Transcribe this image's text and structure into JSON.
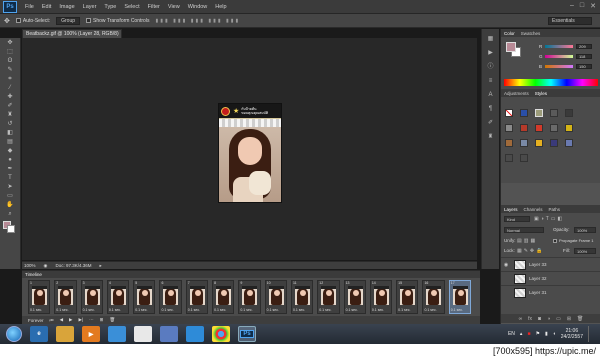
{
  "app": {
    "logo": "Ps",
    "window_controls": [
      "–",
      "□",
      "✕"
    ]
  },
  "menu": [
    "File",
    "Edit",
    "Image",
    "Layer",
    "Type",
    "Select",
    "Filter",
    "View",
    "Window",
    "Help"
  ],
  "options": {
    "auto_select_label": "Auto-Select:",
    "auto_select_value": "Group",
    "transform_label": "Show Transform Controls",
    "workspace": "Essentials"
  },
  "document": {
    "tab_label": "Beatbackz.gif @ 100% (Layer 28, RGB/8) *",
    "banner_text_line1": "กับป้ายต้น",
    "banner_text_line2": "ขอบคุณคุณสมบัติ",
    "zoom": "100%",
    "doc_info": "Doc: 97.3K/4.36M"
  },
  "color_panel": {
    "tabs": [
      "Color",
      "Swatches"
    ],
    "channels": [
      {
        "label": "R",
        "value": "209"
      },
      {
        "label": "G",
        "value": "118"
      },
      {
        "label": "B",
        "value": "150"
      }
    ],
    "fg_color": "#b88a96"
  },
  "styles_panel": {
    "tabs": [
      "Adjustments",
      "Styles"
    ]
  },
  "layers_panel": {
    "tabs": [
      "Layers",
      "Channels",
      "Paths"
    ],
    "kind": "Kind",
    "blend": "Normal",
    "opacity_label": "Opacity:",
    "opacity": "100%",
    "unify_label": "Unify:",
    "propagate_label": "Propagate Frame 1",
    "lock_label": "Lock:",
    "fill_label": "Fill:",
    "fill": "100%",
    "layers": [
      "Layer 33",
      "Layer 32",
      "Layer 31"
    ]
  },
  "timeline": {
    "title": "Timeline",
    "loop": "Forever",
    "frames": [
      {
        "num": "1",
        "delay": "0.1 sec."
      },
      {
        "num": "2",
        "delay": "0.1 sec."
      },
      {
        "num": "3",
        "delay": "0.1 sec."
      },
      {
        "num": "4",
        "delay": "0.1 sec."
      },
      {
        "num": "5",
        "delay": "0.1 sec."
      },
      {
        "num": "6",
        "delay": "0.1 sec."
      },
      {
        "num": "7",
        "delay": "0.1 sec."
      },
      {
        "num": "8",
        "delay": "0.1 sec."
      },
      {
        "num": "9",
        "delay": "0.1 sec."
      },
      {
        "num": "10",
        "delay": "0.1 sec."
      },
      {
        "num": "11",
        "delay": "0.1 sec."
      },
      {
        "num": "12",
        "delay": "0.1 sec."
      },
      {
        "num": "13",
        "delay": "0.1 sec."
      },
      {
        "num": "14",
        "delay": "0.1 sec."
      },
      {
        "num": "15",
        "delay": "0.1 sec."
      },
      {
        "num": "16",
        "delay": "0.1 sec."
      },
      {
        "num": "17",
        "delay": "0.1 sec."
      }
    ],
    "selected_frame": "17"
  },
  "taskbar": {
    "lang": "EN",
    "time": "21:06",
    "date": "24/2/2557",
    "active_app": "Ps"
  },
  "watermark": "[700x595] https://upic.me/"
}
